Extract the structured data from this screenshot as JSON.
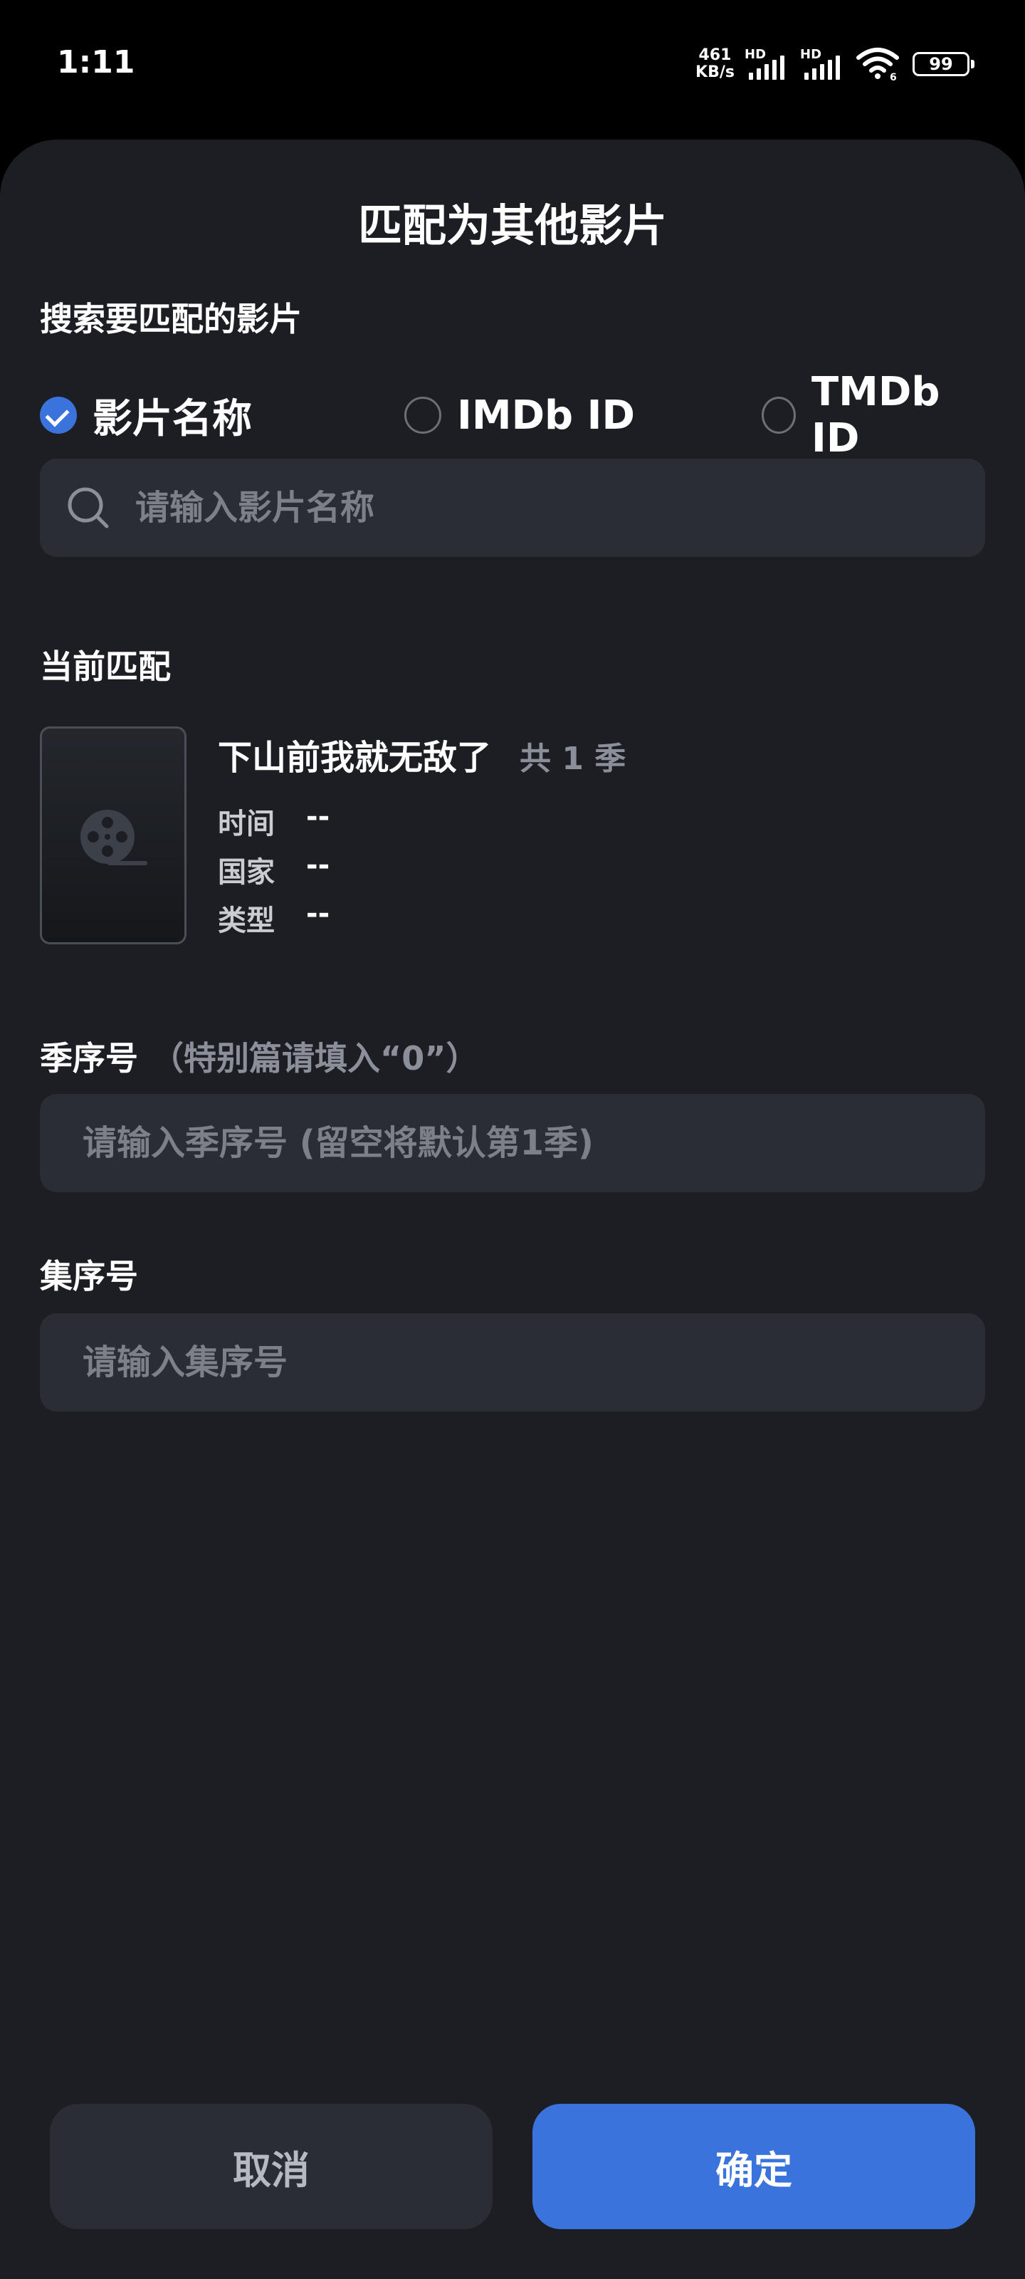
{
  "status_bar": {
    "time": "1:11",
    "net_speed_value": "461",
    "net_speed_unit": "KB/s",
    "signal1_label": "HD",
    "signal2_label": "HD",
    "wifi_badge": "6",
    "battery": "99"
  },
  "sheet": {
    "title": "匹配为其他影片",
    "search_section_label": "搜索要匹配的影片",
    "radio_options": [
      {
        "label": "影片名称",
        "checked": true
      },
      {
        "label": "IMDb ID",
        "checked": false
      },
      {
        "label": "TMDb ID",
        "checked": false
      }
    ],
    "search_placeholder": "请输入影片名称",
    "current_match_label": "当前匹配",
    "current_match": {
      "title": "下山前我就无敌了",
      "seasons": "共 1 季",
      "time_label": "时间",
      "time_value": "--",
      "country_label": "国家",
      "country_value": "--",
      "genre_label": "类型",
      "genre_value": "--"
    },
    "season_label": "季序号",
    "season_hint": "（特别篇请填入“0”）",
    "season_placeholder": "请输入季序号 (留空将默认第1季)",
    "episode_label": "集序号",
    "episode_placeholder": "请输入集序号",
    "cancel_label": "取消",
    "confirm_label": "确定"
  },
  "colors": {
    "accent": "#3a73dc",
    "sheet_bg": "#1c1e23",
    "input_bg": "#2a2d33"
  }
}
